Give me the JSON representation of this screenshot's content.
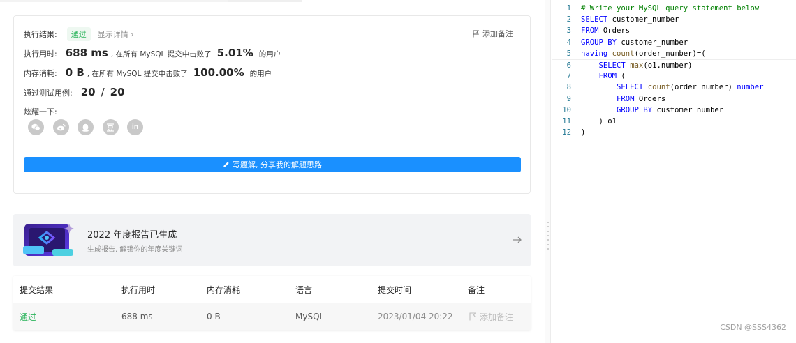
{
  "result": {
    "status_label": "执行结果:",
    "status_value": "通过",
    "detail_link": "显示详情",
    "add_note": "添加备注",
    "runtime_label": "执行用时:",
    "runtime_value": "688 ms",
    "runtime_mid": ", 在所有 MySQL 提交中击败了",
    "runtime_pct": "5.01%",
    "runtime_tail": "的用户",
    "memory_label": "内存消耗:",
    "memory_value": "0 B",
    "memory_mid": ", 在所有 MySQL 提交中击败了",
    "memory_pct": "100.00%",
    "memory_tail": "的用户",
    "tests_label": "通过测试用例:",
    "tests_passed": "20",
    "tests_sep": "/",
    "tests_total": "20",
    "share_label": "炫耀一下:",
    "share_icons": [
      "wechat-icon",
      "weibo-icon",
      "qq-icon",
      "douban-icon",
      "linkedin-icon"
    ],
    "write_button": "写题解, 分享我的解题思路"
  },
  "report": {
    "title": "2022 年度报告已生成",
    "subtitle": "生成报告, 解锁你的年度关键词"
  },
  "history": {
    "headers": [
      "提交结果",
      "执行用时",
      "内存消耗",
      "语言",
      "提交时间",
      "备注"
    ],
    "row": {
      "result": "通过",
      "runtime": "688 ms",
      "memory": "0 B",
      "language": "MySQL",
      "time": "2023/01/04 20:22",
      "note": "添加备注"
    }
  },
  "editor": {
    "lines": [
      {
        "n": "1",
        "code": "# Write your MySQL query statement below"
      },
      {
        "n": "2",
        "code": "SELECT customer_number"
      },
      {
        "n": "3",
        "code": "FROM Orders"
      },
      {
        "n": "4",
        "code": "GROUP BY customer_number"
      },
      {
        "n": "5",
        "code": "having count(order_number)=("
      },
      {
        "n": "6",
        "code": "    SELECT max(o1.number)"
      },
      {
        "n": "7",
        "code": "    FROM ("
      },
      {
        "n": "8",
        "code": "        SELECT count(order_number) number"
      },
      {
        "n": "9",
        "code": "        FROM Orders"
      },
      {
        "n": "10",
        "code": "        GROUP BY customer_number"
      },
      {
        "n": "11",
        "code": "    ) o1"
      },
      {
        "n": "12",
        "code": ")"
      }
    ]
  },
  "watermark": "CSDN @SSS4362",
  "colors": {
    "accent": "#1a90ff",
    "success": "#2db55d",
    "keyword": "#0000ff",
    "comment": "#008000"
  }
}
